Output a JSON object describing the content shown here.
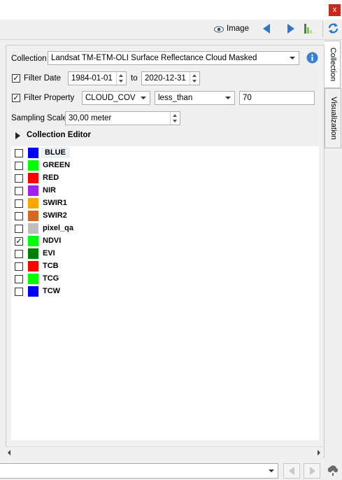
{
  "window": {
    "close_label": "x"
  },
  "toolbar": {
    "image_label": "Image"
  },
  "tabs": [
    "Collection",
    "Visualization"
  ],
  "collection": {
    "label": "Collection",
    "value": "Landsat TM-ETM-OLI Surface Reflectance Cloud Masked"
  },
  "filter_date": {
    "label": "Filter Date",
    "checked": true,
    "start": "1984-01-01",
    "to_label": "to",
    "end": "2020-12-31"
  },
  "filter_property": {
    "label": "Filter Property",
    "checked": true,
    "property": "CLOUD_COVER",
    "operator": "less_than",
    "value": "70"
  },
  "sampling_scale": {
    "label": "Sampling Scale",
    "value": "30,00 meter"
  },
  "collection_editor": {
    "label": "Collection Editor"
  },
  "bands": [
    {
      "name": "BLUE",
      "color": "#0000ff",
      "checked": false
    },
    {
      "name": "GREEN",
      "color": "#00ff00",
      "checked": false
    },
    {
      "name": "RED",
      "color": "#ff0000",
      "checked": false
    },
    {
      "name": "NIR",
      "color": "#a020f0",
      "checked": false
    },
    {
      "name": "SWIR1",
      "color": "#ffa500",
      "checked": false
    },
    {
      "name": "SWIR2",
      "color": "#d2691e",
      "checked": false
    },
    {
      "name": "pixel_qa",
      "color": "#bebebe",
      "checked": false
    },
    {
      "name": "NDVI",
      "color": "#00ff00",
      "checked": true
    },
    {
      "name": "EVI",
      "color": "#008000",
      "checked": false
    },
    {
      "name": "TCB",
      "color": "#ff0000",
      "checked": false
    },
    {
      "name": "TCG",
      "color": "#00ff00",
      "checked": false
    },
    {
      "name": "TCW",
      "color": "#0000ff",
      "checked": false
    }
  ]
}
